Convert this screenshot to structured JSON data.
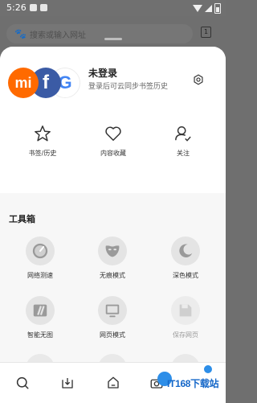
{
  "status_bar": {
    "time": "5:26"
  },
  "search": {
    "placeholder": "搜索或输入网址",
    "tab_count": "1"
  },
  "account": {
    "title": "未登录",
    "subtitle": "登录后可云同步书签历史",
    "logos": [
      "mi-logo",
      "facebook-logo",
      "google-logo"
    ],
    "logo_texts": {
      "mi": "mi",
      "facebook": "f",
      "google": "G"
    }
  },
  "quick_actions": [
    {
      "label": "书签/历史",
      "icon": "star-icon"
    },
    {
      "label": "内容收藏",
      "icon": "heart-icon"
    },
    {
      "label": "关注",
      "icon": "user-follow-icon"
    }
  ],
  "toolbox": {
    "title": "工具箱",
    "items": [
      {
        "label": "网络测速",
        "icon": "speedometer-icon",
        "enabled": true
      },
      {
        "label": "无痕模式",
        "icon": "mask-icon",
        "enabled": true
      },
      {
        "label": "深色模式",
        "icon": "moon-icon",
        "enabled": true
      },
      {
        "label": "智能无图",
        "icon": "no-image-icon",
        "enabled": true
      },
      {
        "label": "网页模式",
        "icon": "desktop-icon",
        "enabled": true
      },
      {
        "label": "保存网页",
        "icon": "save-page-icon",
        "enabled": false
      }
    ]
  },
  "bottom_nav": [
    "search-icon",
    "download-icon",
    "home-icon",
    "camera-icon"
  ],
  "watermark": {
    "text": "IT168下载站"
  },
  "colors": {
    "mi": "#ff6a00",
    "facebook": "#3b5ba5",
    "google_blue": "#4285f4",
    "watermark": "#2d8ee8"
  }
}
